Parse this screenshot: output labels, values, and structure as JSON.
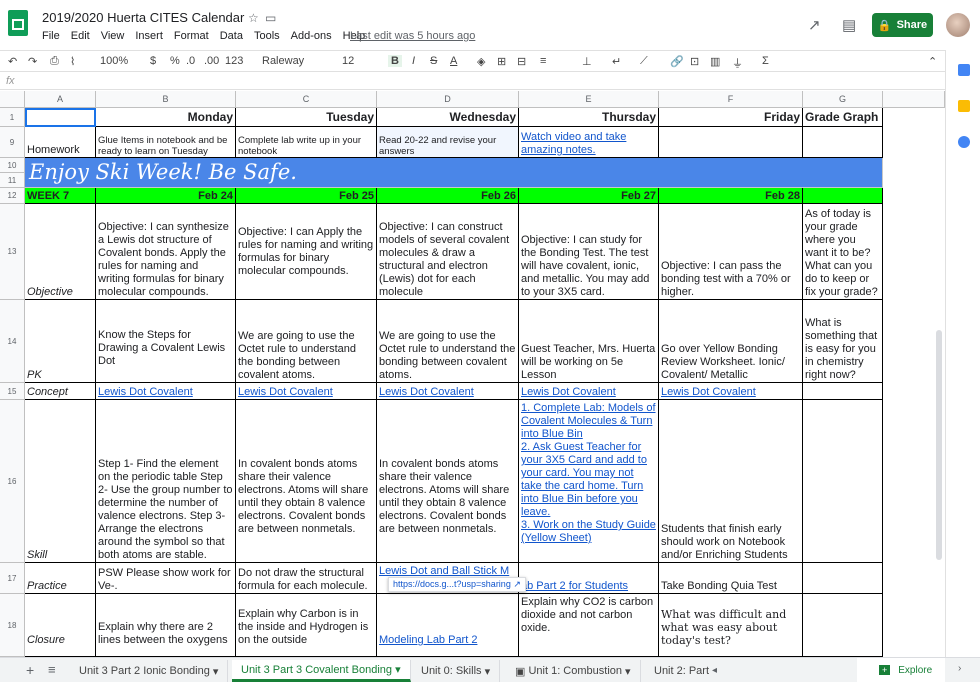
{
  "header": {
    "title": "2019/2020 Huerta CITES Calendar",
    "last_edit": "Last edit was 5 hours ago",
    "share": "Share",
    "menu": [
      "File",
      "Edit",
      "View",
      "Insert",
      "Format",
      "Data",
      "Tools",
      "Add-ons",
      "Help"
    ]
  },
  "toolbar": {
    "zoom": "100%",
    "currency": "$",
    "percent": "%",
    "dec_less": ".0",
    "dec_more": ".00",
    "format": "123",
    "font": "Raleway",
    "size": "12",
    "bold": "B",
    "italic": "I",
    "strike": "S",
    "textcolor": "A"
  },
  "formula": {
    "fx": "fx"
  },
  "columns": [
    "A",
    "B",
    "C",
    "D",
    "E",
    "F",
    "G"
  ],
  "rows": [
    "1",
    "9",
    "10",
    "11",
    "12",
    "13",
    "14",
    "15",
    "16",
    "17",
    "18"
  ],
  "row1": {
    "b": "Monday",
    "c": "Tuesday",
    "d": "Wednesday",
    "e": "Thursday",
    "f": "Friday",
    "g": "Grade Graph"
  },
  "row9": {
    "a": "Homework",
    "b": "Glue Items in notebook and be ready to learn on Tuesday",
    "c": "Complete lab write up in your notebook",
    "d": "Read 20-22 and revise your answers",
    "e": "Watch video and take amazing notes."
  },
  "banner": "Enjoy Ski Week! Be Safe.",
  "row12": {
    "a": "WEEK 7",
    "b": "Feb 24",
    "c": "Feb 25",
    "d": "Feb 26",
    "e": "Feb 27",
    "f": "Feb 28"
  },
  "row13": {
    "a": "Objective",
    "b": "Objective: I can synthesize a Lewis dot structure of Covalent bonds. Apply the rules for naming and writing formulas for binary molecular compounds.",
    "c": "Objective: I can  Apply the rules for naming and writing formulas for binary molecular compounds.",
    "d": "Objective: I can construct models of several covalent molecules & draw a structural and electron (Lewis) dot for each molecule",
    "e": "Objective: I can study for the Bonding Test. The test will have covalent, ionic, and metallic. You may add to your 3X5 card.",
    "f": "Objective: I can pass the bonding test with a 70% or higher.",
    "g": "As of today is your grade where you want it to be? What can you do to keep or fix your grade?"
  },
  "row14": {
    "a": "PK",
    "b": "Know the Steps for Drawing a Covalent Lewis Dot",
    "c": "We are going to use the Octet rule to understand the bonding between covalent atoms.",
    "d": "We are going to use the Octet rule to understand the bonding between covalent atoms.",
    "e": "Guest Teacher, Mrs. Huerta will be working on 5e Lesson",
    "f": "Go over Yellow Bonding Review Worksheet. Ionic/ Covalent/ Metallic",
    "g": "What is something that is easy for you in chemistry right now?"
  },
  "row15": {
    "a": "Concept",
    "b": "Lewis Dot Covalent",
    "c": "Lewis Dot Covalent",
    "d": "Lewis Dot Covalent",
    "e": "Lewis Dot Covalent",
    "f": "Lewis Dot Covalent"
  },
  "row16": {
    "a": "Skill",
    "b": "Step 1- Find the element on the periodic table Step 2- Use the group number to determine the number of valence electrons. Step 3- Arrange the electrons around the symbol so that both atoms are stable.",
    "c": "In covalent bonds atoms share their valence electrons. Atoms will share until they obtain 8 valence electrons. Covalent bonds are between nonmetals.",
    "d": "In covalent bonds atoms share their valence electrons. Atoms will share until they obtain 8 valence electrons. Covalent bonds are between nonmetals.",
    "e1": "1. Complete Lab: Models of Covalent Molecules & Turn into Blue Bin",
    "e2": "2. Ask Guest Teacher for your 3X5 Card and add to your card. You may not take the card home. Turn into Blue Bin before you leave.",
    "e3": "3. Work on the Study Guide (Yellow Sheet)",
    "f": "Students that finish early should work on Notebook and/or Enriching Students"
  },
  "row17": {
    "a": "Practice",
    "b": "PSW Please show work for Ve-.",
    "c": "Do not draw the structural formula for each molecule.",
    "d": "Lewis Dot and Ball Stick M",
    "chip": "https://docs.g...t?usp=sharing",
    "e": "ab Part 2 for Students",
    "f": "Take Bonding Quia Test"
  },
  "row18": {
    "a": "Closure",
    "b": "Explain why there are 2 lines between the oxygens",
    "c": "Explain why Carbon is in the inside and Hydrogen is on the outside",
    "d": "Modeling Lab Part 2",
    "e": "Explain why CO2 is carbon dioxide and not carbon oxide.",
    "f": "What was difficult and what was easy about today's test?"
  },
  "tabs": [
    "Unit 3 Part 2 Ionic Bonding",
    "Unit 3 Part 3 Covalent Bonding",
    "Unit 0: Skills",
    "Unit 1: Combustion",
    "Unit 2: Part"
  ],
  "explore": "Explore",
  "colors": {
    "green": "#00ff00",
    "banner": "#4a86e8",
    "share": "#188038",
    "link": "#1155cc"
  }
}
